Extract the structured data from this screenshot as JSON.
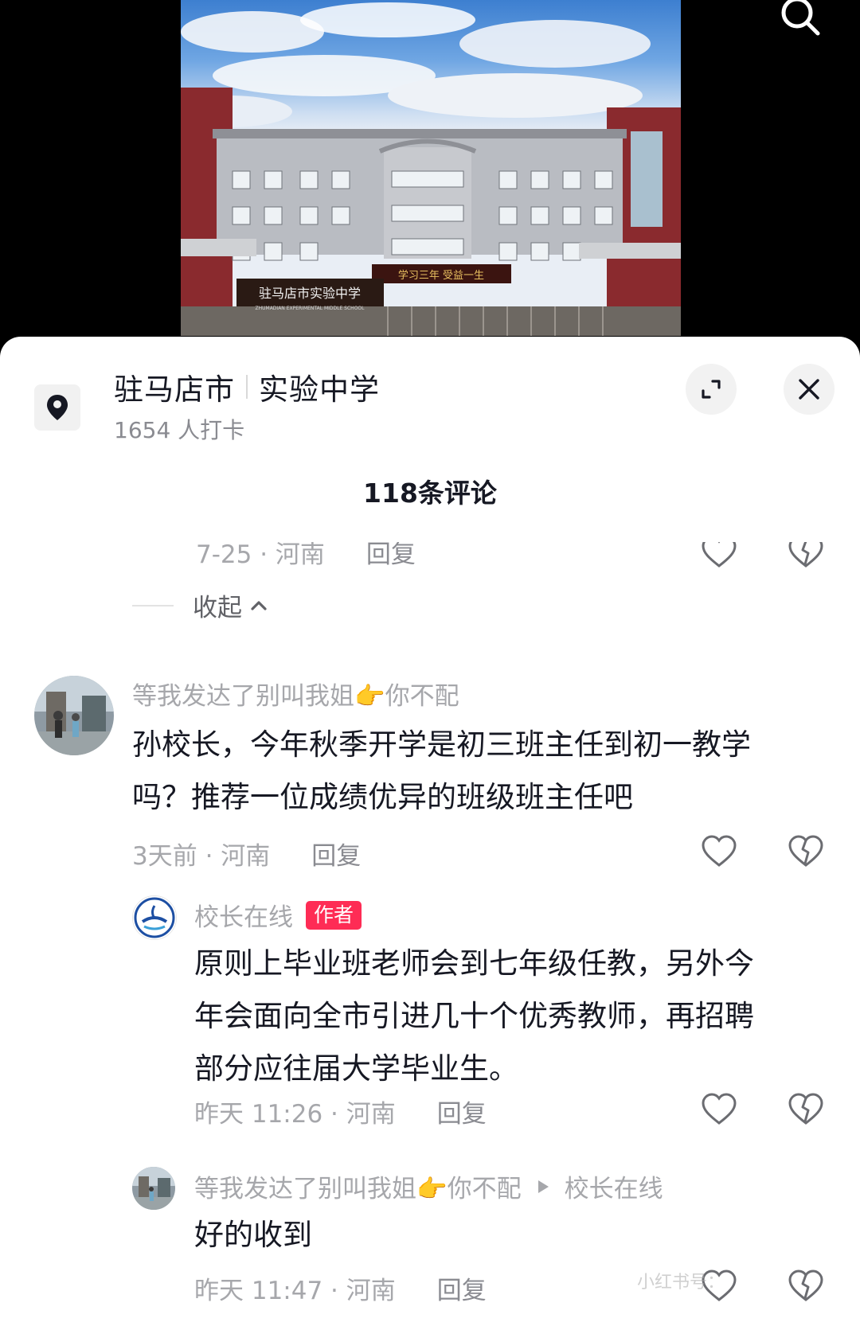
{
  "location": {
    "city": "驻马店市",
    "place": "实验中学",
    "checkin": "1654 人打卡"
  },
  "photo_caption": {
    "signboard_cn": "驻马店市实验中学",
    "signboard_en": "ZHUMADIAN EXPERIMENTAL MIDDLE SCHOOL",
    "banner": "学习三年 受益一生"
  },
  "comments_header": "118条评论",
  "prev_comment": {
    "meta": "7-25 · 河南",
    "reply": "回复"
  },
  "collapse_label": "收起",
  "comment": {
    "username": "等我发达了别叫我姐👉你不配",
    "text_line1": "孙校长，今年秋季开学是初三班主任到初一教学",
    "text_line2": "吗？推荐一位成绩优异的班级班主任吧",
    "meta": "3天前 · 河南",
    "reply": "回复"
  },
  "reply1": {
    "username": "校长在线",
    "badge": "作者",
    "text_line1": "原则上毕业班老师会到七年级任教，另外今",
    "text_line2": "年会面向全市引进几十个优秀教师，再招聘",
    "text_line3": "部分应往届大学毕业生。",
    "meta": "昨天 11:26 · 河南",
    "reply": "回复"
  },
  "reply2": {
    "username": "等我发达了别叫我姐👉你不配",
    "target": "校长在线",
    "text": "好的收到",
    "meta": "昨天 11:47 · 河南",
    "reply": "回复"
  },
  "watermark": "小红书号：",
  "icons": [
    "search-icon",
    "location-pin-icon",
    "expand-icon",
    "close-icon",
    "heart-icon",
    "broken-heart-icon",
    "chevron-up-icon",
    "play-arrow-icon"
  ],
  "colors": {
    "badge": "#fe2c55",
    "text": "#161823",
    "meta": "#a6a7ab"
  }
}
